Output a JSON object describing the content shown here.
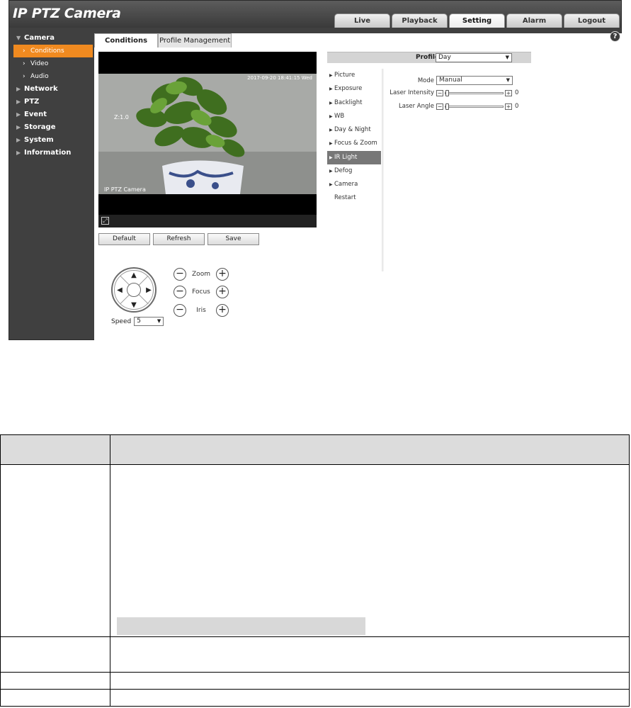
{
  "app": {
    "title": "IP PTZ Camera",
    "top_tabs": [
      {
        "label": "Live"
      },
      {
        "label": "Playback"
      },
      {
        "label": "Setting"
      },
      {
        "label": "Alarm"
      },
      {
        "label": "Logout"
      }
    ],
    "active_tab": "Setting"
  },
  "sidebar": {
    "camera": "Camera",
    "camera_sub": [
      "Conditions",
      "Video",
      "Audio"
    ],
    "sections": [
      "Network",
      "PTZ",
      "Event",
      "Storage",
      "System",
      "Information"
    ]
  },
  "content_tabs": [
    "Conditions",
    "Profile Management"
  ],
  "help_icon": "?",
  "video": {
    "timestamp": "2017-09-20 18:41:15 Wed",
    "zoom_ratio": "Z:1.0",
    "channel_name": "IP PTZ Camera",
    "fullscreen_icon": "⤢"
  },
  "buttons": {
    "default": "Default",
    "refresh": "Refresh",
    "save": "Save"
  },
  "ptz": {
    "speed_label": "Speed",
    "speed_value": "5",
    "zoom": "Zoom",
    "focus": "Focus",
    "iris": "Iris",
    "minus": "−",
    "plus": "+",
    "arrows": {
      "up": "▲",
      "down": "▼",
      "left": "◀",
      "right": "▶"
    }
  },
  "profile": {
    "label": "Profile",
    "value": "Day",
    "caret": "▼"
  },
  "conditions_menu": [
    "Picture",
    "Exposure",
    "Backlight",
    "WB",
    "Day & Night",
    "Focus & Zoom",
    "IR Light",
    "Defog",
    "Camera Restart"
  ],
  "active_menu": "IR Light",
  "ir_light": {
    "mode_label": "Mode",
    "mode_value": "Manual",
    "laser_intensity_label": "Laser Intensity",
    "laser_intensity_value": "0",
    "laser_angle_label": "Laser Angle",
    "laser_angle_value": "0",
    "slider_minus": "−",
    "slider_plus": "+"
  },
  "colors": {
    "accent": "#f08a20",
    "frame": "#404040",
    "menu_active": "#777777"
  }
}
